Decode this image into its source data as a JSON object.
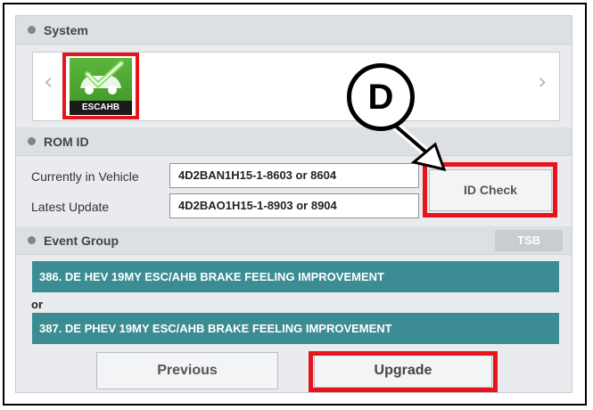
{
  "system": {
    "title": "System",
    "module_label": "ESCAHB",
    "prev_arrow": "chevron-left-icon",
    "next_arrow": "chevron-right-icon"
  },
  "rom_id": {
    "title": "ROM ID",
    "current_label": "Currently in Vehicle",
    "current_value": "4D2BAN1H15-1-8603 or 8604",
    "latest_label": "Latest Update",
    "latest_value": "4D2BAO1H15-1-8903 or 8904",
    "id_check_label": "ID Check"
  },
  "event_group": {
    "title": "Event Group",
    "tsb_label": "TSB",
    "events": [
      "386. DE HEV 19MY ESC/AHB BRAKE FEELING IMPROVEMENT",
      "387. DE PHEV 19MY ESC/AHB BRAKE FEELING IMPROVEMENT"
    ],
    "or_text": "or"
  },
  "footer": {
    "previous_label": "Previous",
    "upgrade_label": "Upgrade"
  },
  "callout": {
    "letter": "D"
  },
  "colors": {
    "highlight": "#e8141b",
    "event_bar": "#3c8c93",
    "module_icon": "#4fa52f"
  }
}
